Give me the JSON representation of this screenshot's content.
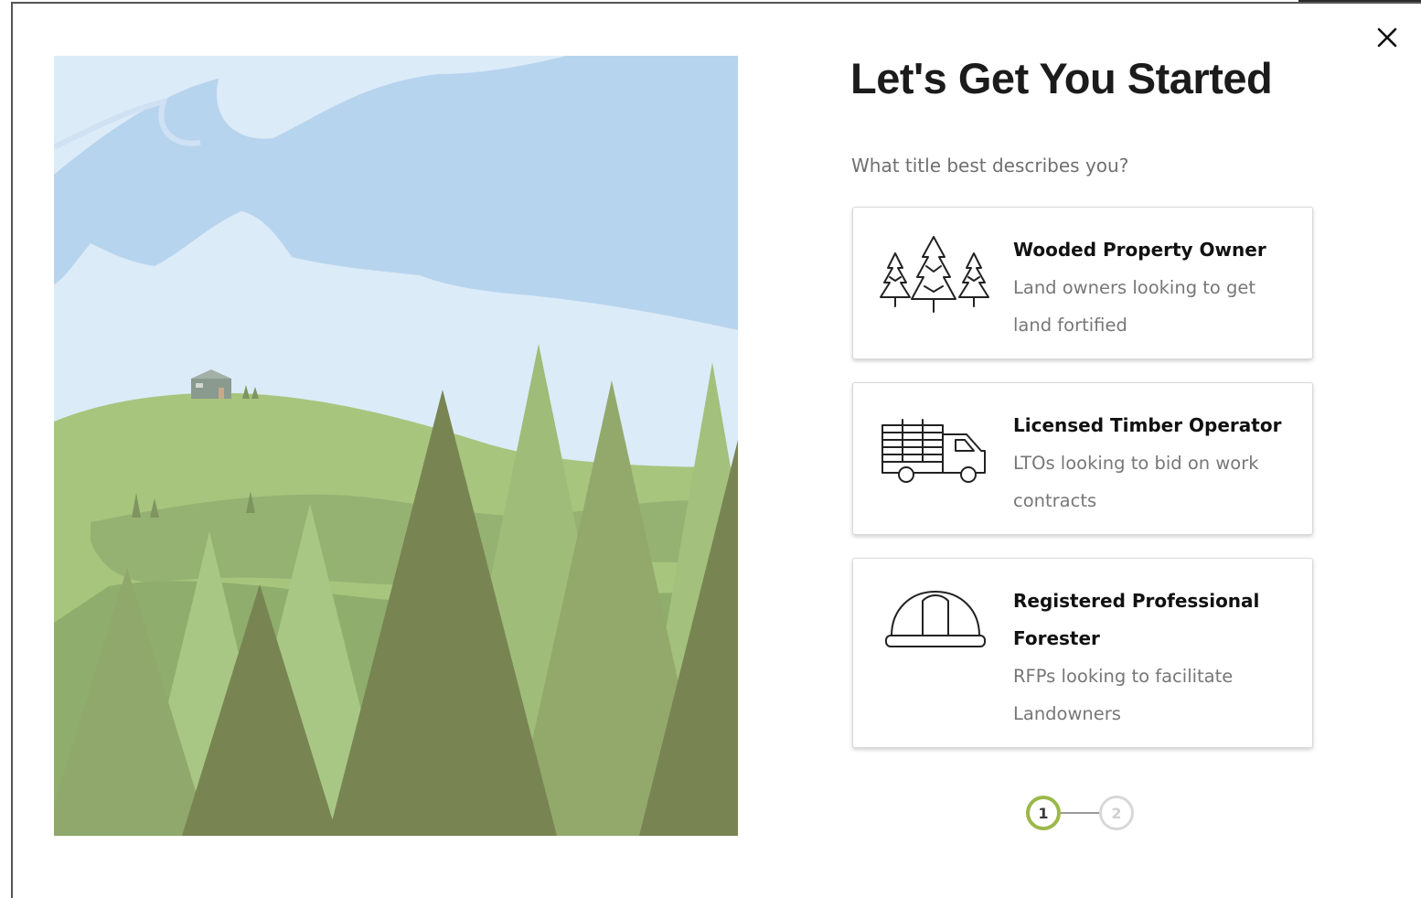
{
  "modal": {
    "title": "Let's Get You Started",
    "close_icon": "close-icon",
    "question": "What title best describes you?"
  },
  "options": [
    {
      "icon": "trees-icon",
      "title": "Wooded Property Owner",
      "description": "Land owners looking to get land fortified"
    },
    {
      "icon": "logging-truck-icon",
      "title": "Licensed Timber Operator",
      "description": "LTOs looking to bid on work contracts"
    },
    {
      "icon": "hard-hat-icon",
      "title": "Registered Professional Forester",
      "description": "RFPs looking to facilitate Landowners"
    }
  ],
  "stepper": {
    "steps": [
      "1",
      "2"
    ],
    "current": "1"
  },
  "colors": {
    "accent": "#9bb84a",
    "sky": "#dcebf8",
    "cloud": "#b7d4ee",
    "forest_dark": "#788553",
    "forest_light": "#a6c37b"
  }
}
